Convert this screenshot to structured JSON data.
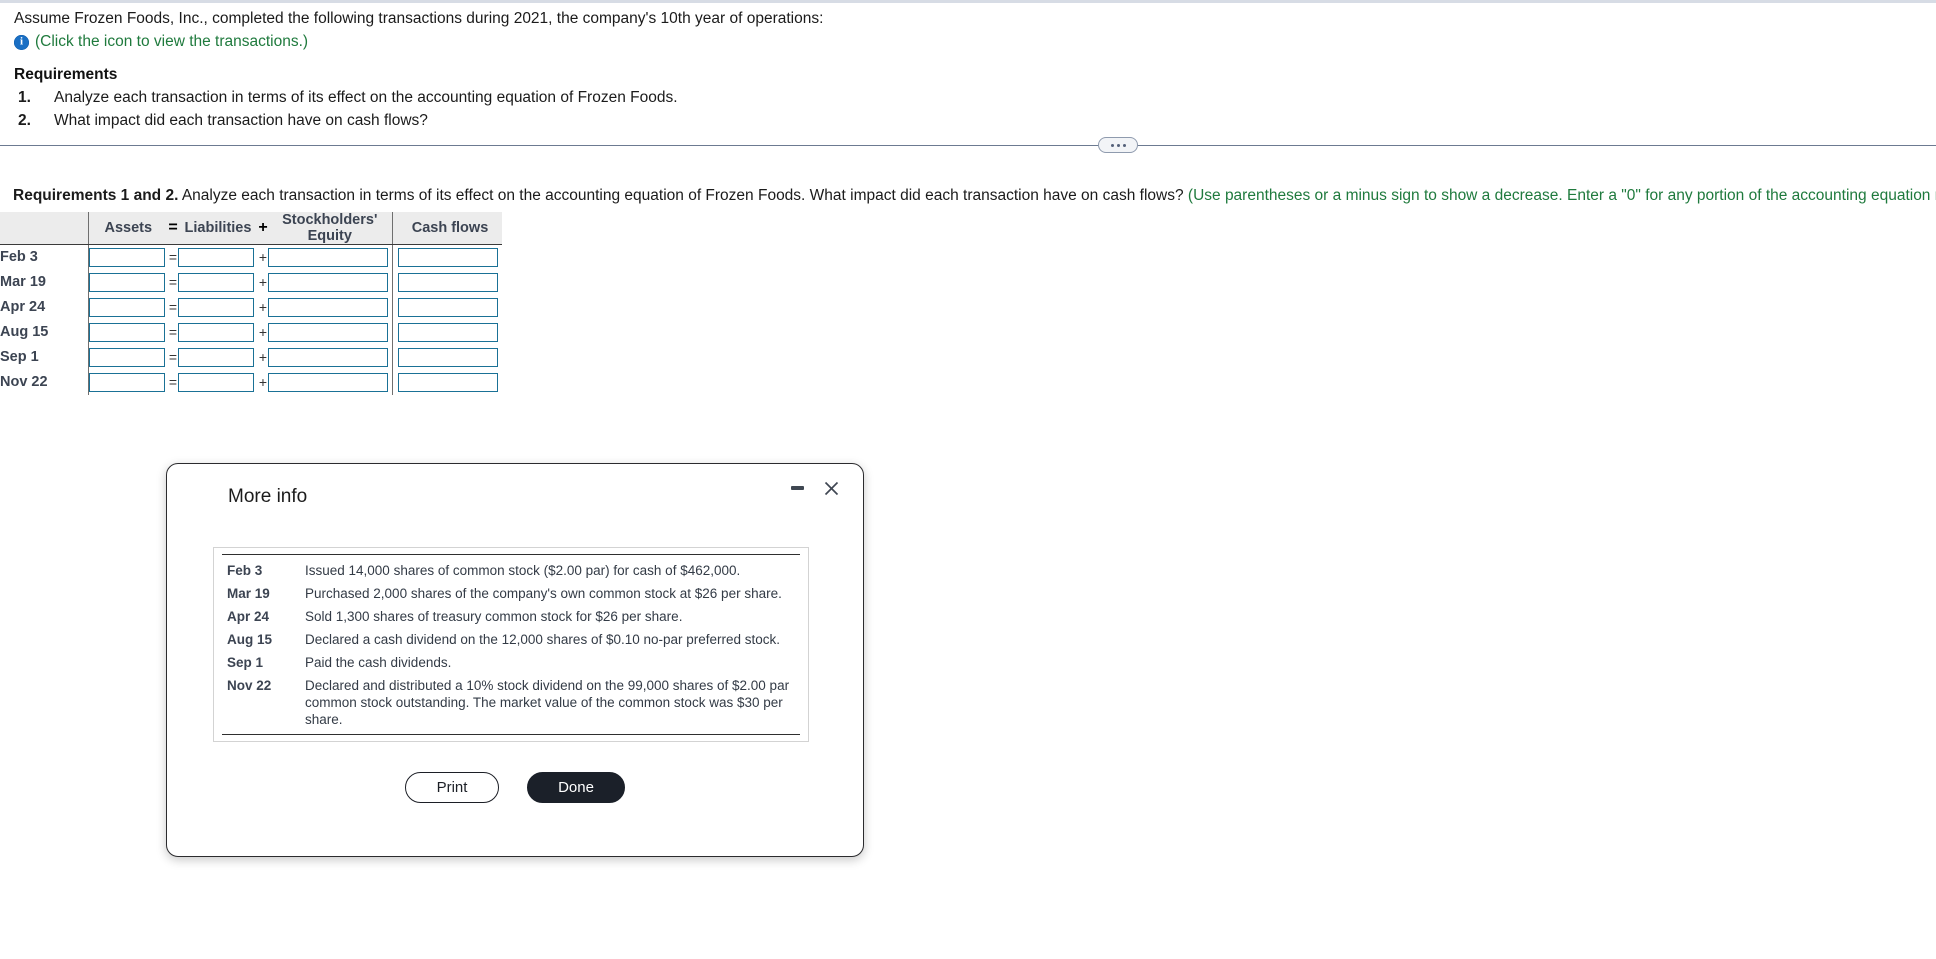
{
  "problem": {
    "statement": "Assume Frozen Foods, Inc., completed the following transactions during 2021, the company's 10th year of operations:",
    "icon_link": "(Click the icon to view the transactions.)",
    "requirements_title": "Requirements",
    "requirements": [
      {
        "num": "1.",
        "text": "Analyze each transaction in terms of its effect on the accounting equation of Frozen Foods."
      },
      {
        "num": "2.",
        "text": "What impact did each transaction have on cash flows?"
      }
    ]
  },
  "divider": {
    "dots_label": "..."
  },
  "answer_section": {
    "heading_bold": "Requirements 1 and 2.",
    "heading_rest": " Analyze each transaction in terms of its effect on the accounting equation of Frozen Foods. What impact did each transaction have on cash flows? ",
    "hint_green": "(Use parentheses or a minus sign to show a decrease. Enter a \"0\" for any portion of the accounting equation not affected by each transaction.)",
    "table": {
      "headers": {
        "row_label": "",
        "assets": "Assets",
        "equals": "=",
        "liabilities": "Liabilities",
        "plus": "+",
        "equity": "Stockholders' Equity",
        "cash_flows": "Cash flows"
      },
      "rows": [
        {
          "date": "Feb 3",
          "assets": "",
          "liabilities": "",
          "equity": "",
          "cash_flows": ""
        },
        {
          "date": "Mar 19",
          "assets": "",
          "liabilities": "",
          "equity": "",
          "cash_flows": ""
        },
        {
          "date": "Apr 24",
          "assets": "",
          "liabilities": "",
          "equity": "",
          "cash_flows": ""
        },
        {
          "date": "Aug 15",
          "assets": "",
          "liabilities": "",
          "equity": "",
          "cash_flows": ""
        },
        {
          "date": "Sep 1",
          "assets": "",
          "liabilities": "",
          "equity": "",
          "cash_flows": ""
        },
        {
          "date": "Nov 22",
          "assets": "",
          "liabilities": "",
          "equity": "",
          "cash_flows": ""
        }
      ]
    }
  },
  "dialog": {
    "title": "More info",
    "minimize_icon": "minimize-icon",
    "close_icon": "close-icon",
    "transactions": [
      {
        "date": "Feb 3",
        "desc": "Issued 14,000 shares of common stock ($2.00 par) for cash of $462,000."
      },
      {
        "date": "Mar 19",
        "desc": "Purchased 2,000 shares of the company's own common stock at $26 per share."
      },
      {
        "date": "Apr 24",
        "desc": "Sold 1,300 shares of treasury common stock for $26 per share."
      },
      {
        "date": "Aug 15",
        "desc": "Declared a cash dividend on the 12,000 shares of $0.10 no-par preferred stock."
      },
      {
        "date": "Sep 1",
        "desc": "Paid the cash dividends."
      },
      {
        "date": "Nov 22",
        "desc": "Declared and distributed a 10% stock dividend on the 99,000 shares of $2.00 par common stock outstanding. The market value of the common stock was $30 per share."
      }
    ],
    "print_label": "Print",
    "done_label": "Done"
  },
  "colors": {
    "link_green": "#1f7a3d",
    "info_blue": "#1a6fc4",
    "input_border": "#1a7196",
    "header_bg": "#ececec",
    "done_bg": "#1b2029"
  }
}
